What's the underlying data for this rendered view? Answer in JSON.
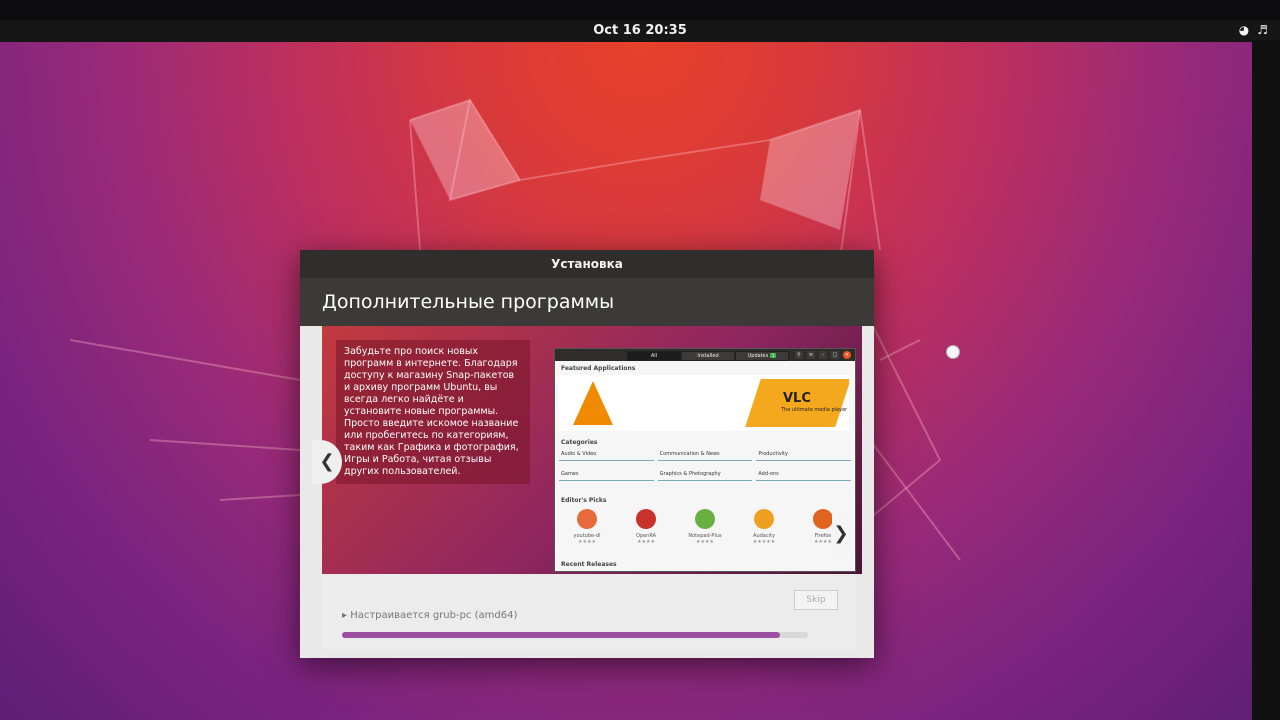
{
  "topbar": {
    "datetime": "Oct 16  20:35",
    "tray_icons": [
      "wifi-icon",
      "volume-icon"
    ]
  },
  "installer": {
    "window_title": "Установка",
    "page_title": "Дополнительные программы",
    "slide_text": "Забудьте про поиск новых программ в интернете. Благодаря доступу к магазину Snap-пакетов и архиву программ Ubuntu, вы всегда легко найдёте и установите новые программы. Просто введите искомое название или пробегитесь по категориям, таким как Графика и фотография, Игры и Работа, читая отзывы других пользователей.",
    "prev_label": "❮",
    "next_label": "❯",
    "skip_label": "Skip",
    "status_text": "▸ Настраивается grub-pc (amd64)",
    "progress": 0.94
  },
  "store": {
    "tabs": [
      "All",
      "Installed",
      "Updates"
    ],
    "updates_count": "1",
    "featured_label": "Featured Applications",
    "banner_title": "VLC",
    "banner_subtitle": "The ultimate media player",
    "categories_label": "Categories",
    "categories": [
      "Audio & Video",
      "Communication & News",
      "Productivity",
      "Games",
      "Graphics & Photography",
      "Add-ons"
    ],
    "picks_label": "Editor's Picks",
    "picks": [
      {
        "name": "youtube-dl",
        "color": "#e86a3a"
      },
      {
        "name": "OpenRA",
        "color": "#c8322a"
      },
      {
        "name": "Notepad-Plus",
        "color": "#69b043"
      },
      {
        "name": "Audacity",
        "color": "#f0a020"
      },
      {
        "name": "Firefox",
        "color": "#e0641f"
      }
    ],
    "recent_label": "Recent Releases"
  },
  "colors": {
    "accent": "#e95420",
    "progress": "#9b4fa0",
    "titlebar": "#2f2e2c"
  }
}
